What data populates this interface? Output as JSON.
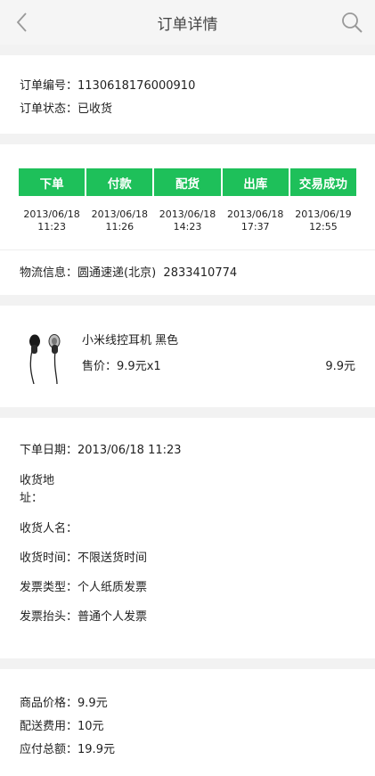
{
  "header": {
    "title": "订单详情"
  },
  "order": {
    "number_label": "订单编号：",
    "number_value": "1130618176000910",
    "status_label": "订单状态：",
    "status_value": "已收货"
  },
  "steps": [
    {
      "label": "下单",
      "date": "2013/06/18",
      "time": "11:23"
    },
    {
      "label": "付款",
      "date": "2013/06/18",
      "time": "11:26"
    },
    {
      "label": "配货",
      "date": "2013/06/18",
      "time": "14:23"
    },
    {
      "label": "出库",
      "date": "2013/06/18",
      "time": "17:37"
    },
    {
      "label": "交易成功",
      "date": "2013/06/19",
      "time": "12:55"
    }
  ],
  "logistics": {
    "label": "物流信息：",
    "value": "圆通速递(北京)  2833410774"
  },
  "product": {
    "name": "小米线控耳机 黑色",
    "price_label": "售价：",
    "price_qty": "9.9元x1",
    "subtotal": "9.9元"
  },
  "details": {
    "order_date_label": "下单日期：",
    "order_date_value": "2013/06/18 11:23",
    "address_label": "收货地址：",
    "address_value": "",
    "receiver_label": "收货人名：",
    "receiver_value": "",
    "delivery_time_label": "收货时间：",
    "delivery_time_value": "不限送货时间",
    "invoice_type_label": "发票类型：",
    "invoice_type_value": "个人纸质发票",
    "invoice_title_label": "发票抬头：",
    "invoice_title_value": "普通个人发票"
  },
  "totals": {
    "goods_price_label": "商品价格：",
    "goods_price_value": "9.9元",
    "shipping_label": "配送费用：",
    "shipping_value": "10元",
    "total_label": "应付总额：",
    "total_value": "19.9元"
  },
  "colors": {
    "accent": "#1ec05a",
    "header_bg": "#f5f5f5",
    "gap_bg": "#f2f2f2"
  },
  "icons": {
    "back": "chevron-left-icon",
    "search": "search-icon",
    "product": "earphones-image"
  }
}
